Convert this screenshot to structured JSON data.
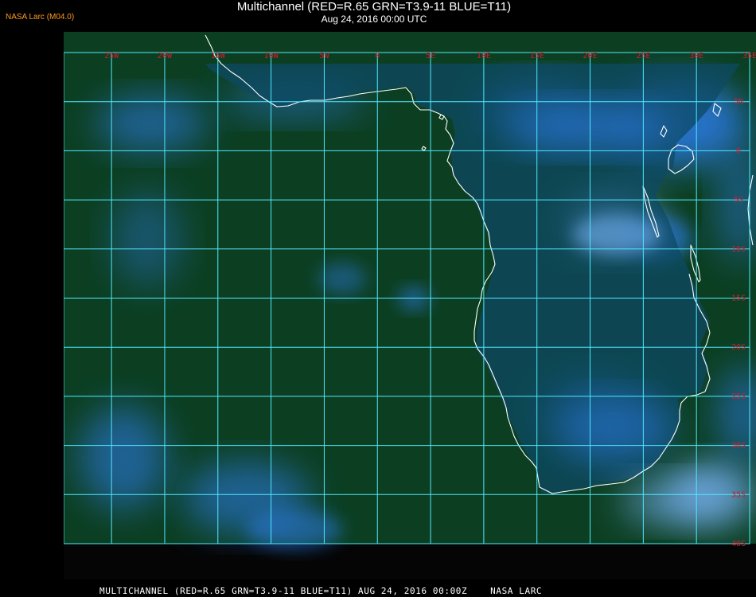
{
  "header": {
    "agency_tag": "NASA Larc (M04.0)",
    "title": "Multichannel (RED=R.65 GRN=T3.9-11 BLUE=T11)",
    "subtitle": "Aug 24, 2016 00:00 UTC"
  },
  "footer": {
    "caption": "MULTICHANNEL (RED=R.65 GRN=T3.9-11 BLUE=T11) AUG 24, 2016 00:00Z    NASA LARC"
  },
  "map": {
    "longitude_labels": [
      "25W",
      "20W",
      "15W",
      "10W",
      "5W",
      "0",
      "5E",
      "10E",
      "15E",
      "20E",
      "25E",
      "30E",
      "35E"
    ],
    "latitude_labels": [
      "5N",
      "0",
      "5S",
      "10S",
      "15S",
      "20S",
      "25S",
      "30S",
      "35S",
      "40S"
    ],
    "colors": {
      "grid": "#4fe9ff",
      "label": "#d41c2c",
      "coast": "#ffffff",
      "ocean": "#0c3f22",
      "land": "#0e4a63",
      "cloud": "#2f7ff0",
      "bright_cloud": "#7db8ff"
    }
  }
}
